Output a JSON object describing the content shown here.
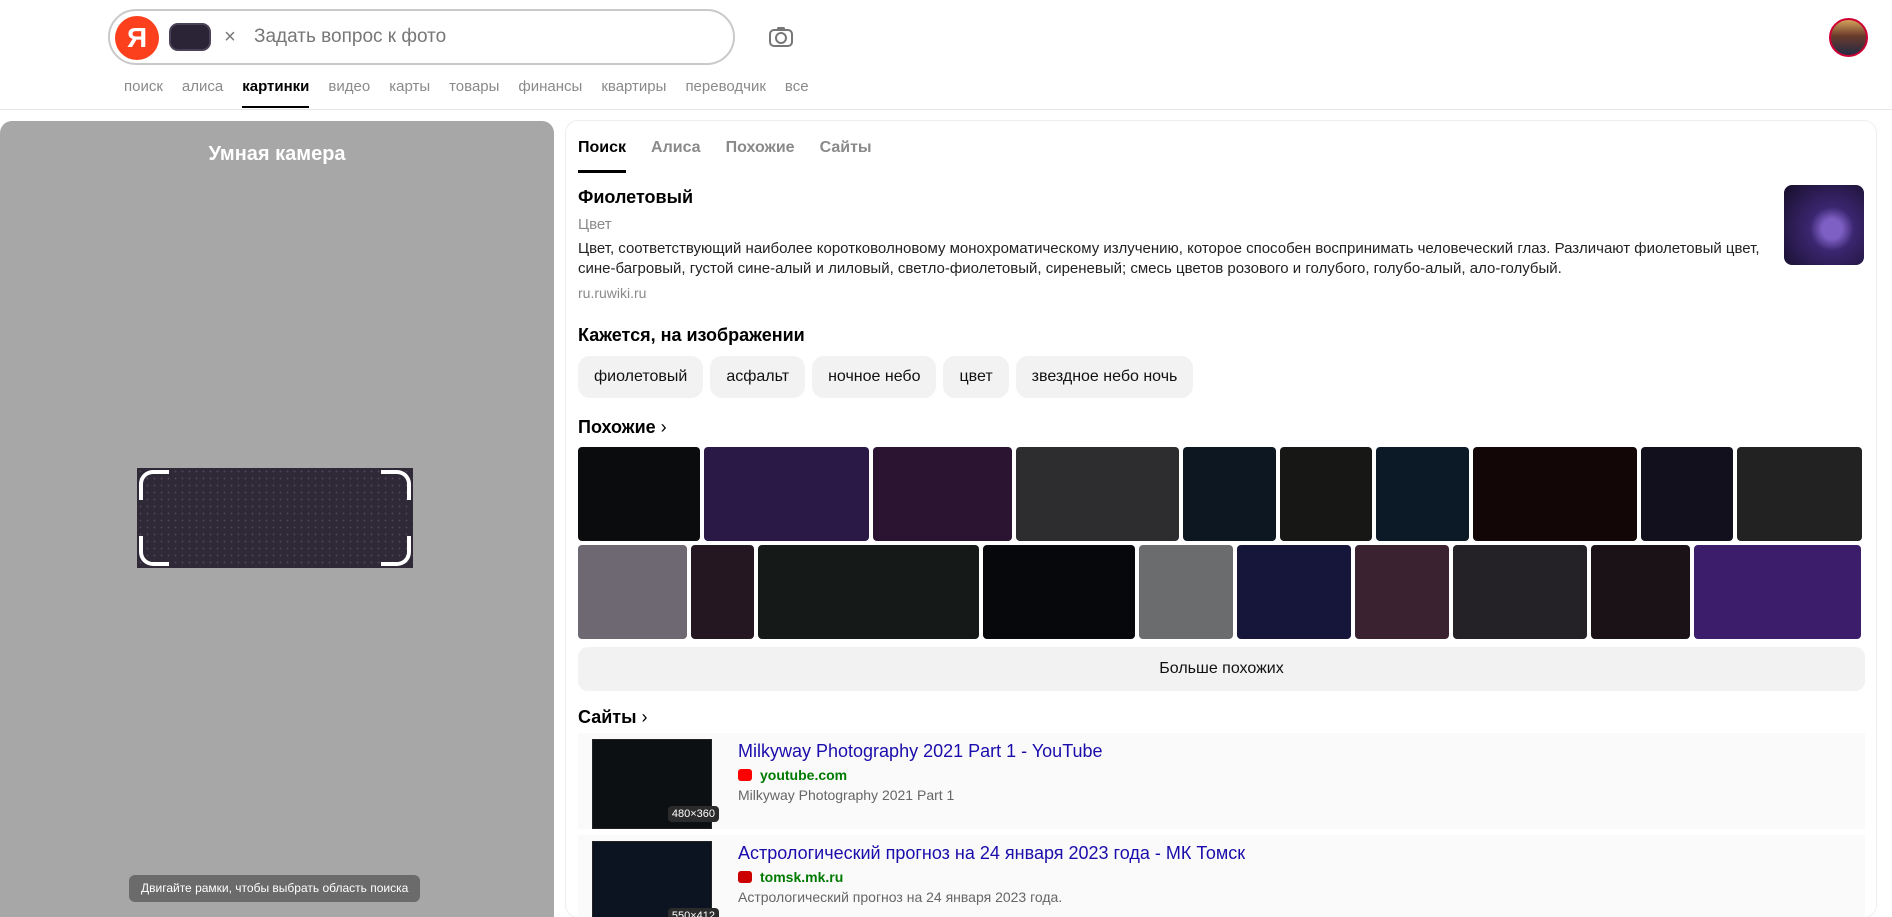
{
  "search": {
    "placeholder": "Задать вопрос к фото",
    "logo": "Я"
  },
  "nav": [
    "поиск",
    "алиса",
    "картинки",
    "видео",
    "карты",
    "товары",
    "финансы",
    "квартиры",
    "переводчик",
    "все"
  ],
  "nav_active": "картинки",
  "camera": {
    "title": "Умная камера",
    "hint": "Двигайте рамки, чтобы выбрать область поиска"
  },
  "tabs": [
    "Поиск",
    "Алиса",
    "Похожие",
    "Сайты"
  ],
  "fact": {
    "title": "Фиолетовый",
    "subtitle": "Цвет",
    "description": "Цвет, соответствующий наиболее коротковолновому монохроматическому излучению, которое способен воспринимать человеческий глаз. Различают фиолетовый цвет, сине-багровый, густой сине-алый и лиловый, светло-фиолетовый, сиреневый; смесь цветов розового и голубого, голубо-алый, ало-голубый.",
    "source": "ru.ruwiki.ru"
  },
  "seems": {
    "title": "Кажется, на изображении",
    "chips": [
      "фиолетовый",
      "асфальт",
      "ночное небо",
      "цвет",
      "звездное небо ночь"
    ]
  },
  "similar": {
    "title": "Похожие",
    "more_button": "Больше похожих",
    "row1_colors": [
      "#0b0c0e",
      "#2a1847",
      "#2b1431",
      "#2d2d30",
      "#0d1722",
      "#171815",
      "#0b1a26",
      "#120606",
      "#12101d",
      "#222222"
    ],
    "row2_colors": [
      "#6e6873",
      "#251721",
      "#151a18",
      "#07080c",
      "#6a6c6e",
      "#16153a",
      "#3a2230",
      "#242226",
      "#1a1216",
      "#3b1d6b"
    ]
  },
  "sites": {
    "title": "Сайты",
    "items": [
      {
        "title": "Milkyway Photography 2021 Part 1 - YouTube",
        "host": "youtube.com",
        "snippet": "Milkyway Photography 2021 Part 1",
        "dims": "480×360",
        "favicon_color": "#ff0000"
      },
      {
        "title": "Астрологический прогноз на 24 января 2023 года - МК Томск",
        "host": "tomsk.mk.ru",
        "snippet": "Астрологический прогноз на 24 января 2023 года.",
        "dims": "550×412",
        "favicon_color": "#cc0000"
      }
    ]
  }
}
